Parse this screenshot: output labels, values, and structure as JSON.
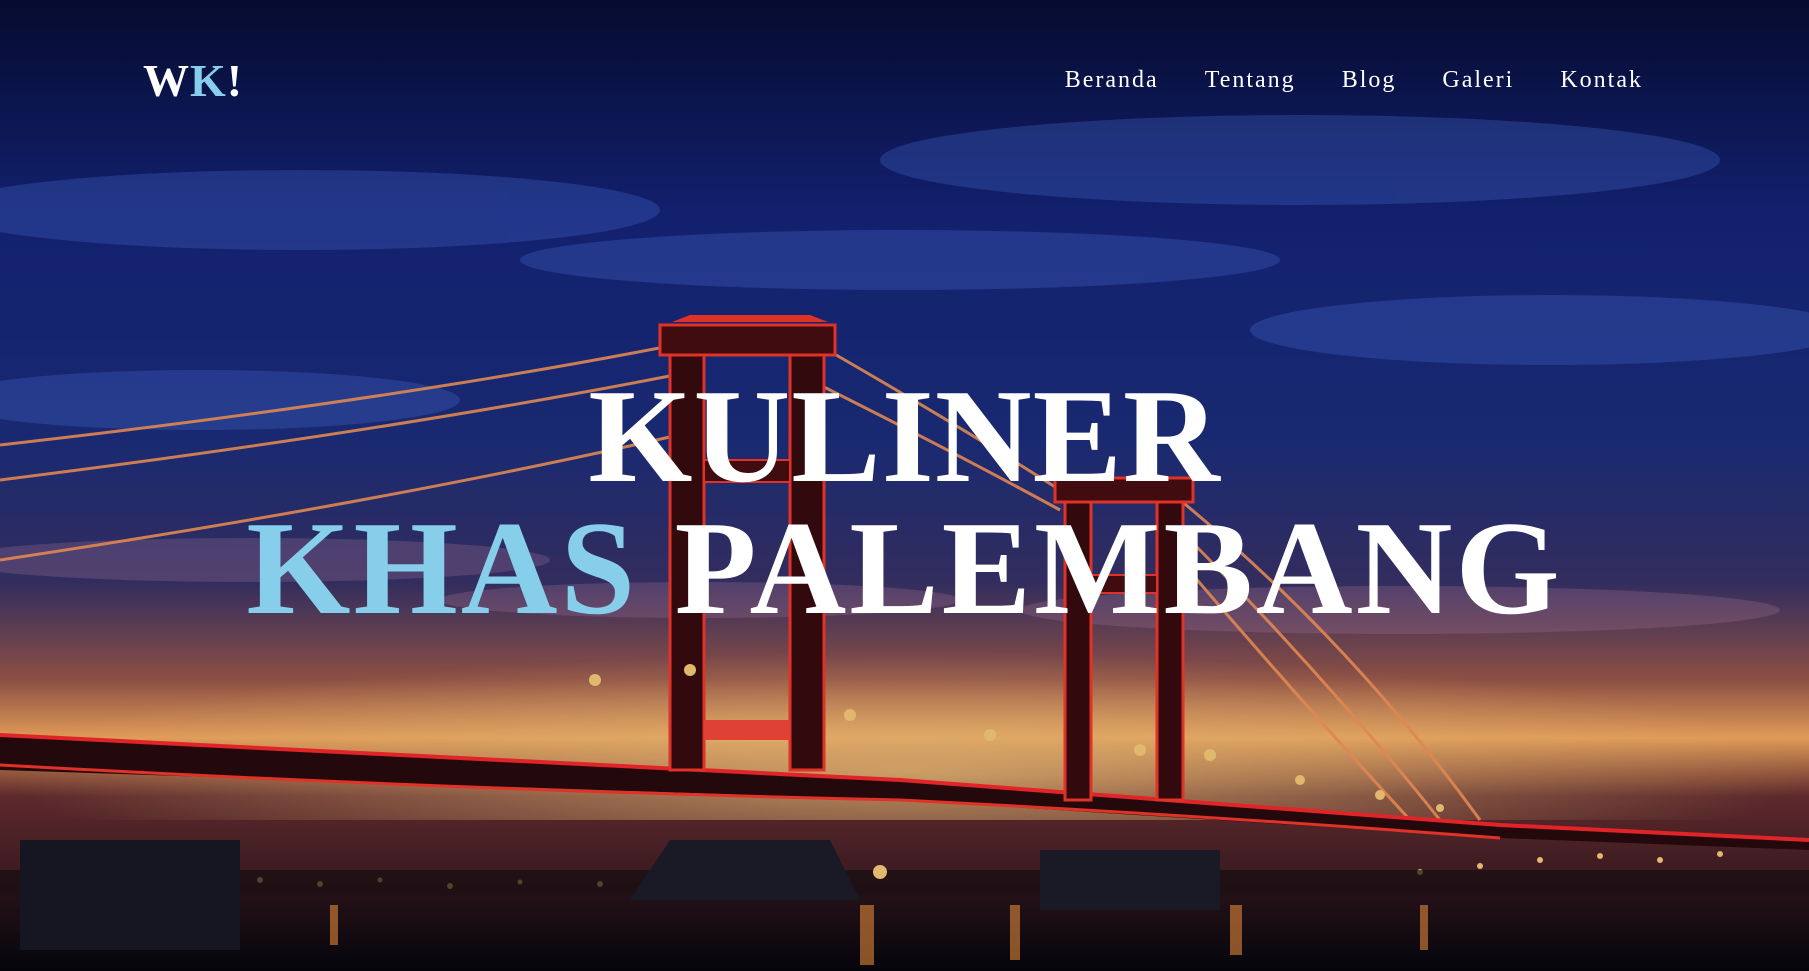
{
  "logo": {
    "part1": "W",
    "part2": "K",
    "part3": "!"
  },
  "nav": {
    "items": [
      {
        "label": "Beranda"
      },
      {
        "label": "Tentang"
      },
      {
        "label": "Blog"
      },
      {
        "label": "Galeri"
      },
      {
        "label": "Kontak"
      }
    ]
  },
  "hero": {
    "line1": "KULINER",
    "line2_accent": "KHAS",
    "line2_rest": "PALEMBANG"
  },
  "colors": {
    "accent": "#87ceeb",
    "text": "#ffffff"
  }
}
